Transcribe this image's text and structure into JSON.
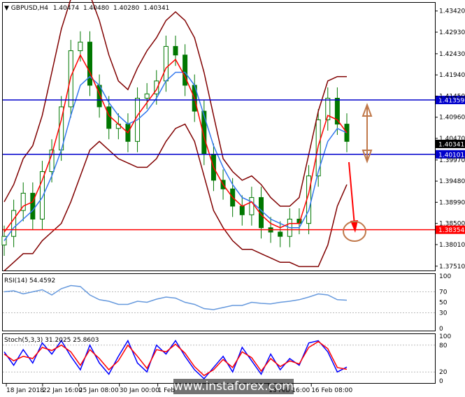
{
  "chart_data": {
    "type": "line",
    "symbol": "GBPUSD,H4",
    "ohlc": [
      "1.40474",
      "1.40480",
      "1.40280",
      "1.40341"
    ],
    "x_labels": [
      "18 Jan 2018",
      "22 Jan 16:00",
      "25 Jan 08:00",
      "30 Jan 00:00",
      "1 Feb",
      "13 Feb 16:00",
      "16 Feb 08:00"
    ],
    "price_panel": {
      "y_ticks": [
        "1.43420",
        "1.42930",
        "1.42430",
        "1.41940",
        "1.41450",
        "1.40960",
        "1.40470",
        "1.39970",
        "1.39480",
        "1.38990",
        "1.38500",
        "1.38010",
        "1.37510"
      ],
      "ylim": [
        1.3741,
        1.4361
      ],
      "levels": [
        {
          "value": 1.41359,
          "label": "1.41359",
          "color": "#0000cc"
        },
        {
          "value": 1.40101,
          "label": "1.40101",
          "color": "#0000cc"
        },
        {
          "value": 1.38354,
          "label": "1.38354",
          "color": "#ff0000"
        }
      ],
      "current_price": {
        "value": 1.40341,
        "label": "1.40341"
      },
      "close": [
        1.382,
        1.388,
        1.392,
        1.386,
        1.397,
        1.402,
        1.412,
        1.425,
        1.427,
        1.417,
        1.412,
        1.407,
        1.408,
        1.404,
        1.414,
        1.415,
        1.418,
        1.426,
        1.424,
        1.417,
        1.411,
        1.401,
        1.395,
        1.393,
        1.389,
        1.387,
        1.391,
        1.384,
        1.383,
        1.382,
        1.386,
        1.385,
        1.396,
        1.409,
        1.414,
        1.408,
        1.404
      ],
      "ma_fast": [
        1.383,
        1.386,
        1.389,
        1.39,
        1.395,
        1.401,
        1.409,
        1.419,
        1.424,
        1.42,
        1.415,
        1.41,
        1.408,
        1.406,
        1.41,
        1.413,
        1.416,
        1.421,
        1.423,
        1.419,
        1.414,
        1.405,
        1.398,
        1.394,
        1.391,
        1.389,
        1.39,
        1.387,
        1.385,
        1.384,
        1.385,
        1.385,
        1.392,
        1.403,
        1.41,
        1.409,
        1.406
      ],
      "ma_slow": [
        1.381,
        1.384,
        1.386,
        1.388,
        1.391,
        1.396,
        1.402,
        1.41,
        1.417,
        1.419,
        1.417,
        1.413,
        1.41,
        1.408,
        1.409,
        1.411,
        1.414,
        1.418,
        1.42,
        1.42,
        1.417,
        1.41,
        1.403,
        1.398,
        1.394,
        1.391,
        1.39,
        1.388,
        1.386,
        1.385,
        1.384,
        1.384,
        1.388,
        1.397,
        1.404,
        1.407,
        1.406
      ],
      "bb_upper": [
        1.39,
        1.394,
        1.4,
        1.403,
        1.41,
        1.42,
        1.43,
        1.437,
        1.44,
        1.438,
        1.432,
        1.424,
        1.418,
        1.416,
        1.421,
        1.425,
        1.428,
        1.432,
        1.434,
        1.432,
        1.428,
        1.42,
        1.41,
        1.4,
        1.397,
        1.395,
        1.396,
        1.394,
        1.391,
        1.389,
        1.389,
        1.391,
        1.401,
        1.411,
        1.418,
        1.419,
        1.419
      ],
      "bb_lower": [
        1.374,
        1.376,
        1.378,
        1.378,
        1.381,
        1.383,
        1.385,
        1.39,
        1.396,
        1.402,
        1.404,
        1.402,
        1.4,
        1.399,
        1.398,
        1.398,
        1.4,
        1.404,
        1.407,
        1.408,
        1.404,
        1.396,
        1.388,
        1.384,
        1.381,
        1.379,
        1.379,
        1.378,
        1.377,
        1.376,
        1.376,
        1.375,
        1.375,
        1.375,
        1.38,
        1.389,
        1.394
      ]
    },
    "rsi_panel": {
      "label": "RSI(14) 54.4592",
      "y_ticks": [
        "100",
        "70",
        "50",
        "30",
        "0"
      ],
      "ylim": [
        0,
        100
      ],
      "values": [
        70,
        72,
        66,
        70,
        74,
        64,
        76,
        82,
        80,
        64,
        55,
        52,
        46,
        46,
        52,
        50,
        56,
        60,
        58,
        50,
        46,
        38,
        36,
        40,
        44,
        44,
        50,
        48,
        47,
        50,
        52,
        55,
        60,
        66,
        64,
        55,
        54
      ]
    },
    "stoch_panel": {
      "label": "Stoch(5,3,3) 31.2025 25.8603",
      "y_ticks": [
        "100",
        "80",
        "20",
        "0"
      ],
      "ylim": [
        0,
        100
      ],
      "k": [
        65,
        35,
        70,
        40,
        85,
        60,
        90,
        55,
        25,
        80,
        40,
        15,
        55,
        90,
        40,
        20,
        80,
        60,
        90,
        55,
        25,
        5,
        30,
        55,
        20,
        75,
        45,
        15,
        60,
        25,
        50,
        35,
        85,
        90,
        65,
        20,
        31
      ],
      "d": [
        60,
        45,
        55,
        50,
        75,
        68,
        80,
        65,
        35,
        70,
        50,
        25,
        45,
        80,
        55,
        28,
        70,
        65,
        82,
        62,
        32,
        12,
        25,
        48,
        30,
        65,
        52,
        22,
        50,
        32,
        45,
        38,
        75,
        88,
        72,
        30,
        26
      ]
    }
  },
  "watermark": "www.instaforex.com",
  "colors": {
    "candle": "#007700",
    "ma_fast": "#ff0000",
    "ma_slow": "#3377ee",
    "band": "#800000",
    "level_blue": "#0000cc",
    "level_red": "#ff0000",
    "rsi": "#6699dd",
    "stoch_k": "#0000ff",
    "stoch_d": "#ff0000",
    "annot_brown": "#c0784a",
    "annot_red": "#ff0000"
  }
}
